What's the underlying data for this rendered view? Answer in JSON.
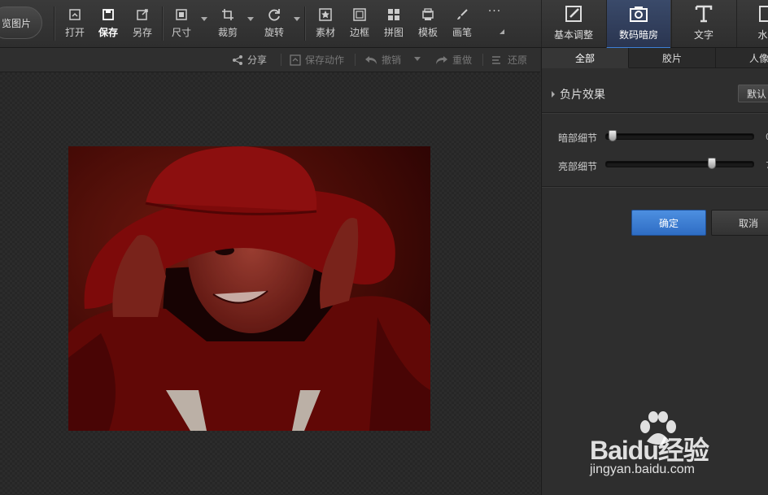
{
  "toolbar": {
    "open_pic_label": "览图片",
    "items": [
      {
        "label": "打开",
        "icon": "open-icon"
      },
      {
        "label": "保存",
        "icon": "save-icon"
      },
      {
        "label": "另存",
        "icon": "save-as-icon"
      },
      {
        "label": "尺寸",
        "icon": "resize-icon"
      },
      {
        "label": "裁剪",
        "icon": "crop-icon"
      },
      {
        "label": "旋转",
        "icon": "rotate-icon"
      },
      {
        "label": "素材",
        "icon": "material-icon"
      },
      {
        "label": "边框",
        "icon": "border-icon"
      },
      {
        "label": "拼图",
        "icon": "collage-icon"
      },
      {
        "label": "模板",
        "icon": "template-icon"
      },
      {
        "label": "画笔",
        "icon": "brush-icon"
      }
    ],
    "more_label": "···"
  },
  "right_tabs": [
    {
      "label": "基本调整",
      "icon": "adjust-icon"
    },
    {
      "label": "数码暗房",
      "icon": "camera-icon"
    },
    {
      "label": "文字",
      "icon": "text-icon"
    },
    {
      "label": "水",
      "icon": "watermark-icon"
    }
  ],
  "action_bar": {
    "share": "分享",
    "save_action": "保存动作",
    "undo": "撤销",
    "redo": "重做",
    "restore": "还原"
  },
  "panel": {
    "tabs": [
      "全部",
      "胶片",
      "人像"
    ],
    "section_title": "负片效果",
    "default_button": "默认",
    "sliders": [
      {
        "label": "暗部细节",
        "value": "0",
        "level": 0.02
      },
      {
        "label": "亮部细节",
        "value": "7",
        "level": 0.73
      }
    ],
    "ok_button": "确定",
    "cancel_button": "取消"
  },
  "watermark": {
    "brand": "Baidu经验",
    "url": "jingyan.baidu.com"
  }
}
